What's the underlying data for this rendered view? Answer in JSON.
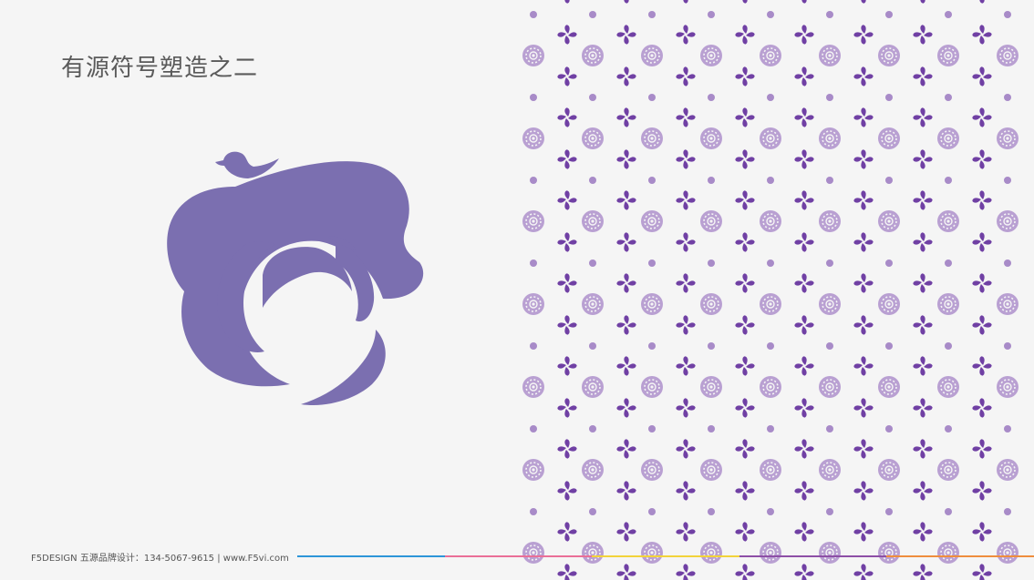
{
  "slide": {
    "title": "有源符号塑造之二",
    "footer": "F5DESIGN 五源品牌设计：134-5067-9615 | www.F5vi.com"
  },
  "colors": {
    "background": "#f5f5f5",
    "brand_purple": "#7b6fb0",
    "pattern_light": "#b9a0d2",
    "pattern_dark": "#7040a4",
    "footer_line": [
      "#2d95d8",
      "#ea6f97",
      "#f2d33a",
      "#8d4fa6",
      "#ef8d3d"
    ]
  },
  "icons": {
    "logo": "bird-rose-swirl-logo",
    "pattern": [
      "flower-medallion-icon",
      "petal-x-icon",
      "dot-icon"
    ]
  }
}
